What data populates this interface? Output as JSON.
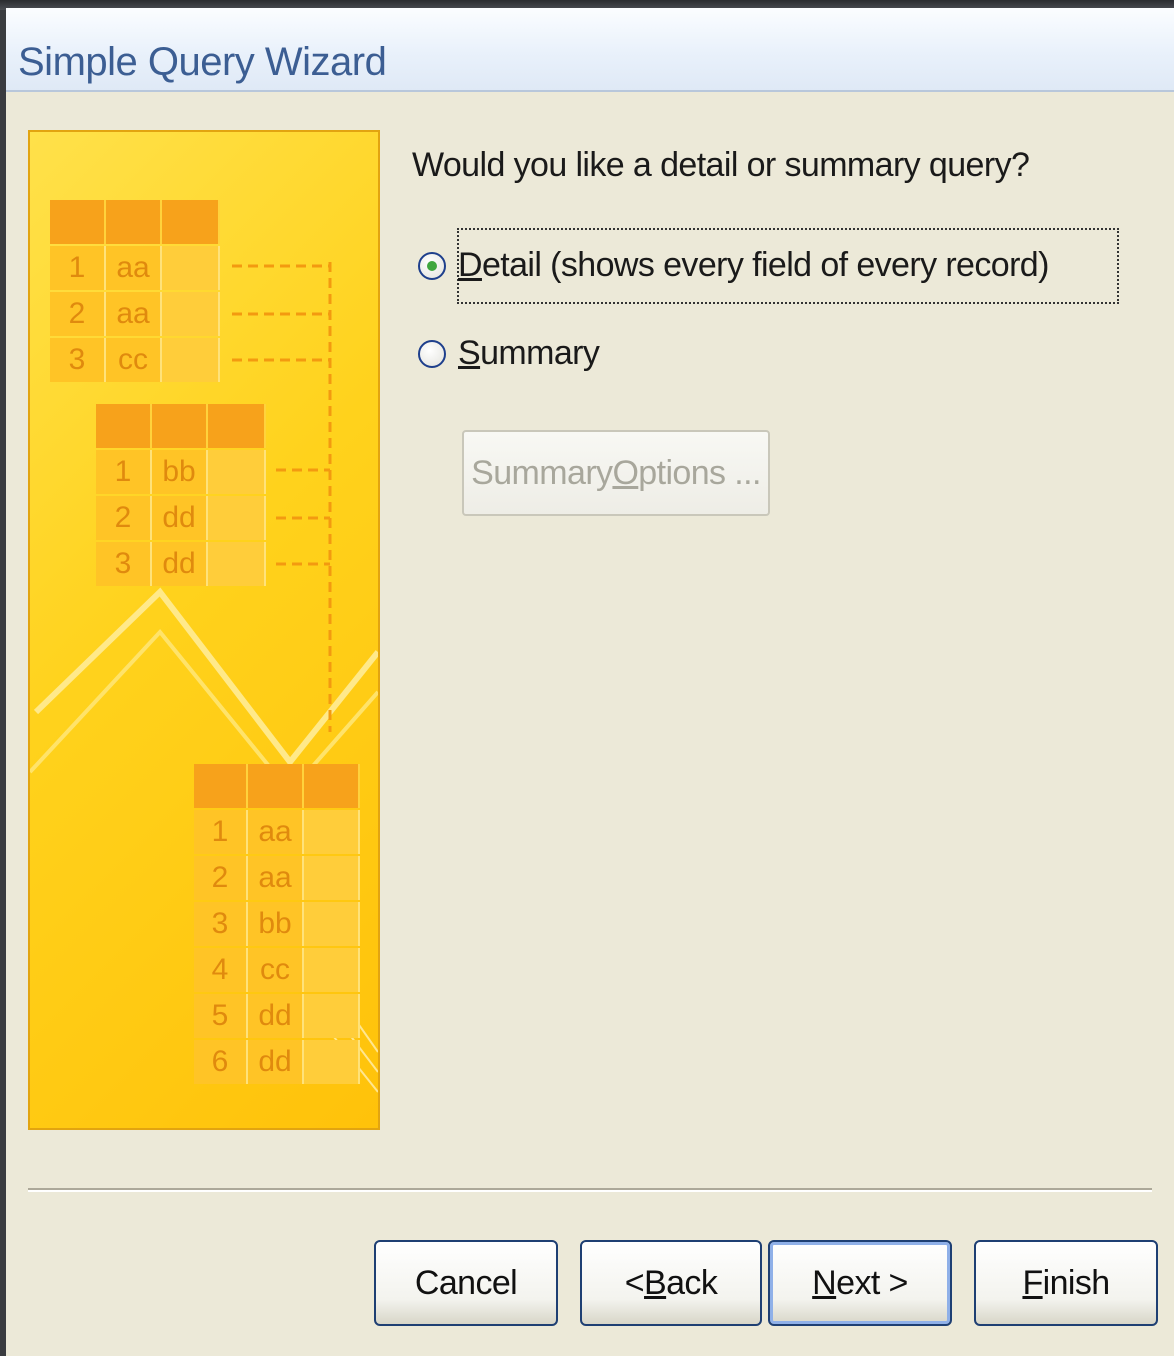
{
  "window": {
    "title": "Simple Query Wizard"
  },
  "illustration": {
    "table_top": [
      [
        "1",
        "aa"
      ],
      [
        "2",
        "aa"
      ],
      [
        "3",
        "cc"
      ]
    ],
    "table_middle": [
      [
        "1",
        "bb"
      ],
      [
        "2",
        "dd"
      ],
      [
        "3",
        "dd"
      ]
    ],
    "table_result": [
      [
        "1",
        "aa"
      ],
      [
        "2",
        "aa"
      ],
      [
        "3",
        "bb"
      ],
      [
        "4",
        "cc"
      ],
      [
        "5",
        "dd"
      ],
      [
        "6",
        "dd"
      ]
    ]
  },
  "main": {
    "question": "Would you like a detail or summary query?",
    "options": [
      {
        "mnemonic": "D",
        "rest": "etail (shows every field of every record)",
        "selected": true
      },
      {
        "mnemonic": "S",
        "rest": "ummary",
        "selected": false
      }
    ],
    "summary_options_button": {
      "before": "Summary ",
      "mnemonic": "O",
      "after": "ptions ...",
      "enabled": false
    }
  },
  "footer": {
    "cancel": {
      "before": "Cancel",
      "mnemonic": "",
      "after": ""
    },
    "back": {
      "before": "< ",
      "mnemonic": "B",
      "after": "ack"
    },
    "next": {
      "before": "",
      "mnemonic": "N",
      "after": "ext >"
    },
    "finish": {
      "before": "",
      "mnemonic": "F",
      "after": "inish"
    }
  },
  "colors": {
    "title_text": "#3c5e93",
    "panel_yellow": "#ffd21c",
    "panel_orange": "#f7a21b",
    "dialog_bg": "#ece9d8",
    "button_border": "#1e3f73",
    "radio_selected": "#3fa63f"
  }
}
